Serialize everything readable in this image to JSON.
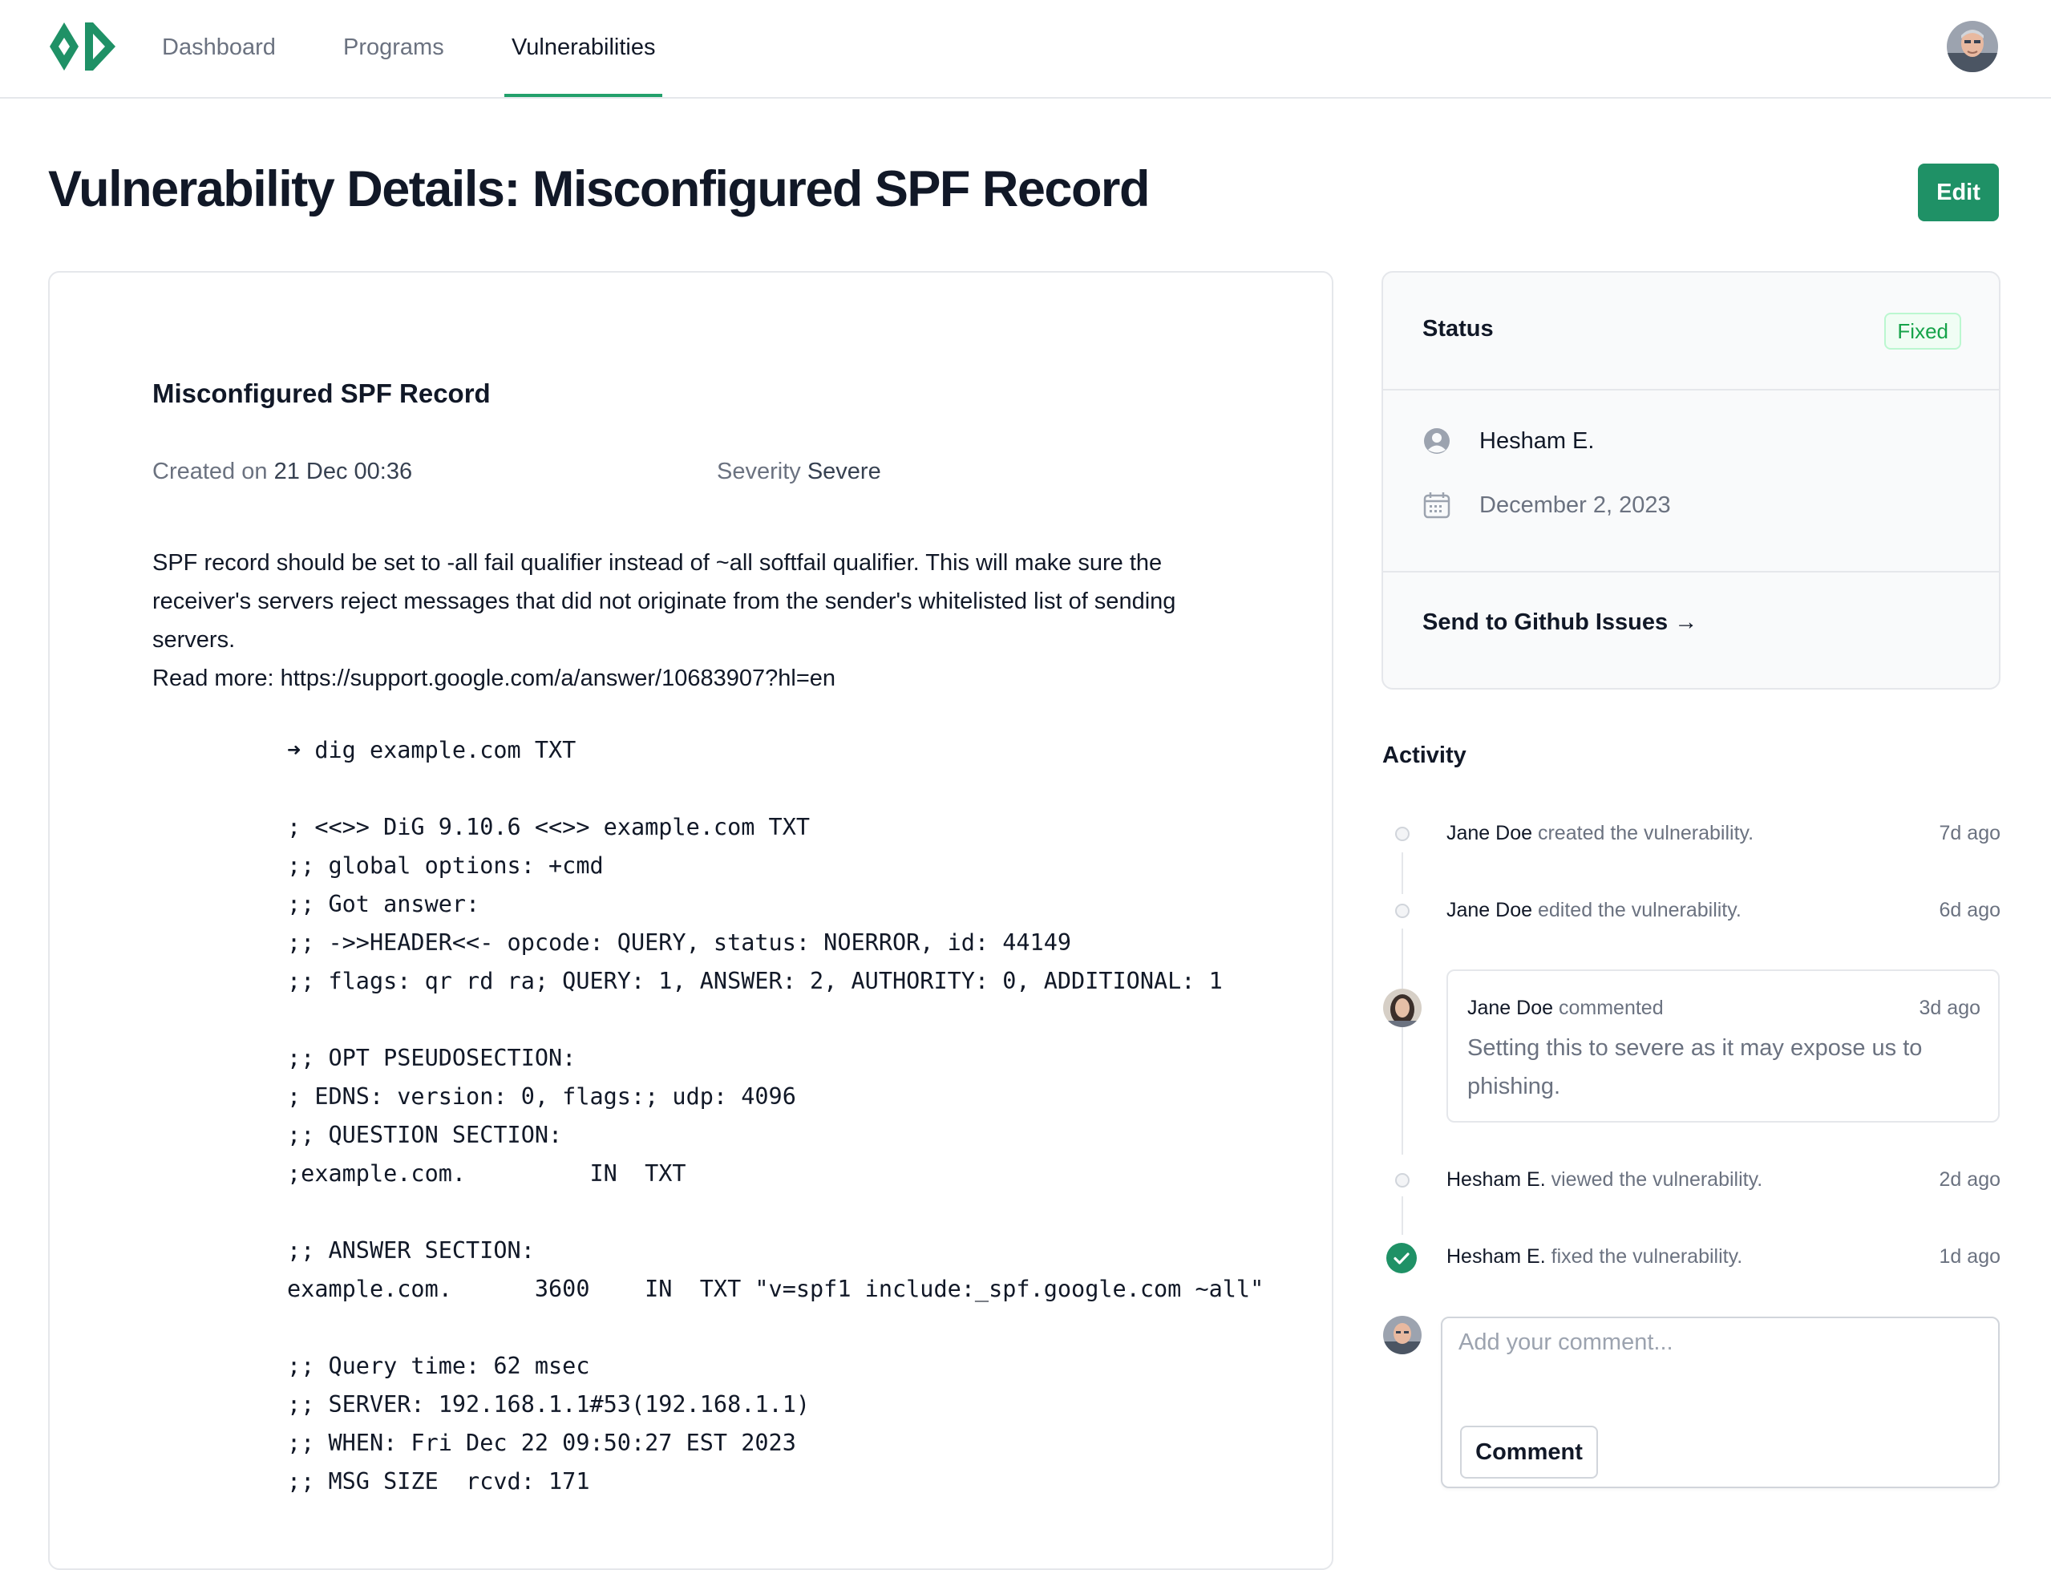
{
  "nav": {
    "tabs": [
      {
        "label": "Dashboard",
        "active": false
      },
      {
        "label": "Programs",
        "active": false
      },
      {
        "label": "Vulnerabilities",
        "active": true
      }
    ],
    "logo_icon": "brand-logo",
    "avatar_icon": "user-avatar"
  },
  "header": {
    "title": "Vulnerability Details: Misconfigured SPF Record",
    "edit_label": "Edit"
  },
  "details": {
    "title": "Misconfigured SPF Record",
    "created_label": "Created on",
    "created_value": "21 Dec 00:36",
    "severity_label": "Severity",
    "severity_value": "Severe",
    "description": [
      "SPF record should be set to -all fail qualifier instead of ~all softfail qualifier. This will make sure the receiver's servers reject messages that did not originate from the sender's whitelisted list of sending servers.",
      "Read more: https://support.google.com/a/answer/10683907?hl=en"
    ],
    "code": "➜ dig example.com TXT\n\n; <<>> DiG 9.10.6 <<>> example.com TXT\n;; global options: +cmd\n;; Got answer:\n;; ->>HEADER<<- opcode: QUERY, status: NOERROR, id: 44149\n;; flags: qr rd ra; QUERY: 1, ANSWER: 2, AUTHORITY: 0, ADDITIONAL: 1\n\n;; OPT PSEUDOSECTION:\n; EDNS: version: 0, flags:; udp: 4096\n;; QUESTION SECTION:\n;example.com.         IN  TXT\n\n;; ANSWER SECTION:\nexample.com.      3600    IN  TXT \"v=spf1 include:_spf.google.com ~all\"\n\n;; Query time: 62 msec\n;; SERVER: 192.168.1.1#53(192.168.1.1)\n;; WHEN: Fri Dec 22 09:50:27 EST 2023\n;; MSG SIZE  rcvd: 171"
  },
  "status": {
    "label": "Status",
    "badge": "Fixed",
    "badge_color": "#16a34a",
    "assignee": "Hesham E.",
    "assignee_icon": "user-circle-icon",
    "date": "December 2, 2023",
    "date_icon": "calendar-icon",
    "github_link": "Send to Github Issues →"
  },
  "activity": {
    "title": "Activity",
    "items": [
      {
        "who": "Jane Doe",
        "action": "created the vulnerability.",
        "time": "7d ago"
      },
      {
        "who": "Jane Doe",
        "action": "edited the vulnerability.",
        "time": "6d ago"
      },
      {
        "who": "Jane Doe",
        "action": "commented",
        "time": "3d ago",
        "comment": "Setting this to severe as it may expose us to phishing."
      },
      {
        "who": "Hesham E.",
        "action": "viewed the vulnerability.",
        "time": "2d ago"
      },
      {
        "who": "Hesham E.",
        "action": "fixed the vulnerability.",
        "time": "1d ago"
      }
    ],
    "new_comment": {
      "placeholder": "Add your comment...",
      "button_label": "Comment"
    }
  },
  "colors": {
    "accent": "#1f9166",
    "accent_light": "#22a06b",
    "fixed_badge_bg": "#f0fdf4"
  }
}
